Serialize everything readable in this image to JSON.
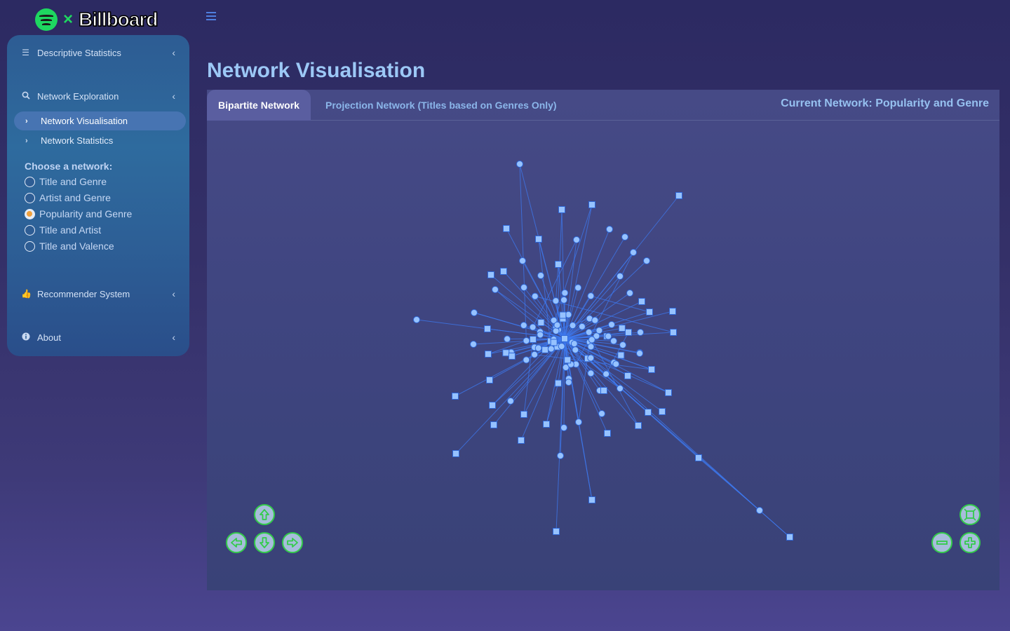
{
  "header": {
    "logo_text": "Billboard",
    "logo_separator": "×",
    "menu_toggle_icon": "hamburger-icon"
  },
  "sidebar": {
    "menus": [
      {
        "label": "Descriptive Statistics",
        "icon": "list-icon"
      },
      {
        "label": "Network Exploration",
        "icon": "search-icon",
        "children": [
          {
            "label": "Network Visualisation",
            "active": true
          },
          {
            "label": "Network Statistics",
            "active": false
          }
        ]
      },
      {
        "label": "Recommender System",
        "icon": "thumbs-up-icon"
      },
      {
        "label": "About",
        "icon": "info-icon"
      }
    ],
    "choose_label": "Choose a network:",
    "network_options": [
      {
        "label": "Title and Genre",
        "checked": false
      },
      {
        "label": "Artist and Genre",
        "checked": false
      },
      {
        "label": "Popularity and Genre",
        "checked": true
      },
      {
        "label": "Title and Artist",
        "checked": false
      },
      {
        "label": "Title and Valence",
        "checked": false
      }
    ]
  },
  "main": {
    "title": "Network Visualisation",
    "tabs": [
      {
        "label": "Bipartite Network",
        "active": true
      },
      {
        "label": "Projection Network (Titles based on Genres Only)",
        "active": false
      }
    ],
    "current_network": "Current Network: Popularity and Genre",
    "controls": {
      "up": "arrow-up-icon",
      "down": "arrow-down-icon",
      "left": "arrow-left-icon",
      "right": "arrow-right-icon",
      "zoom_in": "zoom-in-icon",
      "zoom_out": "zoom-out-icon",
      "fit": "fit-view-icon"
    }
  },
  "colors": {
    "node_fill": "#96c2ff",
    "node_stroke": "#2f68d8",
    "edge": "#3d7af0",
    "accent_green": "#33cc4a",
    "radio_selected": "#f0a13e"
  }
}
